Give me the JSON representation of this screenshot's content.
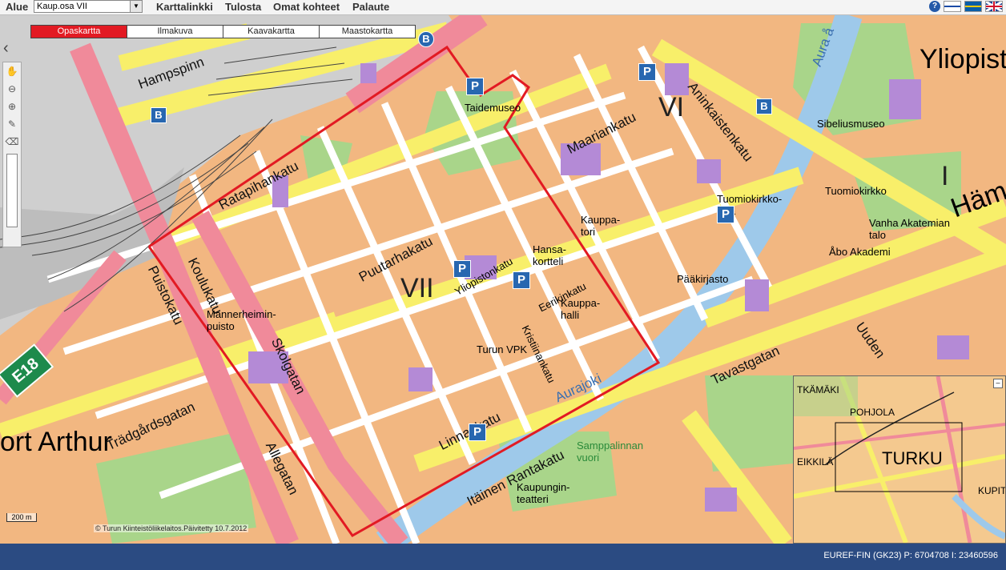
{
  "header": {
    "alue_label": "Alue",
    "alue_value": "Kaup.osa VII",
    "menu": [
      "Karttalinkki",
      "Tulosta",
      "Omat kohteet",
      "Palaute"
    ],
    "help": "?"
  },
  "tabs": [
    {
      "label": "Opaskartta",
      "active": true
    },
    {
      "label": "Ilmakuva",
      "active": false
    },
    {
      "label": "Kaavakartta",
      "active": false
    },
    {
      "label": "Maastokartta",
      "active": false
    }
  ],
  "map": {
    "scale": "200 m",
    "copyright": "© Turun Kiinteistöliikelaitos.Päivitetty 10.7.2012",
    "labels": {
      "vii": "VII",
      "vi": "VI",
      "i": "I",
      "port_arthur": "ort Arthur",
      "ylioplisto": "Yliopist",
      "hame": "Häme",
      "e18": "E18",
      "koulukatu": "Koulukatu",
      "skolgatan": "Skolgatan",
      "puistokatu": "Puistokatu",
      "allegatan": "Allegatan",
      "ratapihankatu": "Ratapihankatu",
      "puutarhakatu": "Puutarhakatu",
      "itainen_rantakatu": "Itäinen Rantakatu",
      "tavastgatan": "Tavastgatan",
      "aninkaistenkatu": "Aninkaistenkatu",
      "hampspinn": "Hampspinn",
      "kauppatori": "Kauppa-\ntori",
      "kauppahalli": "Kauppa-\nhalli",
      "mannerheimin_puisto": "Mannerheimin-\npuisto",
      "aurajoki": "Aurajoki",
      "aura": "Aura å",
      "unden": "Uuden",
      "tradgardsgatan": "Trädgårdsgatan",
      "eerikinkatu": "Eerikinkatu",
      "linnankatu": "Linnankatu",
      "kristiinankatu": "Kristiinankatu",
      "yliopistonkatu": "Yliopistonkatu",
      "maariankatu": "Maariankatu",
      "tuomiokirkkosilta": "Tuomiokirkko-\nsilta",
      "sibeliusmuseo": "Sibeliusmuseo",
      "tuomiokirkko": "Tuomiokirkko",
      "vanha_akatemian_talo": "Vanha Akatemian\ntalo",
      "abo_akademi": "Åbo Akademi",
      "taidemuseo": "Taidemuseo",
      "turun_vpk": "Turun VPK",
      "hansa": "Hansa-\nkortteli",
      "kaupunginteatteri": "Kaupungin-\nteatteri",
      "samppalinnan_vuori": "Samppalinnan\nvuori",
      "paakirjasto": "Pääkirjasto",
      "ylioplisto_short": "Yliopist"
    },
    "overview": {
      "labels": [
        "TKÄMÄKI",
        "POHJOLA",
        "TURKU",
        "EIKKILÄ",
        "KUPIT"
      ]
    }
  },
  "statusbar": {
    "coords": "EUREF-FIN (GK23) P: 6704708 I: 23460596"
  },
  "colors": {
    "map_bg": "#f2b781",
    "road_yellow": "#f8ef6a",
    "road_pink": "#f08a9a",
    "park_green": "#a9d58a",
    "water_blue": "#9ec9ea",
    "building_purple": "#b48ad6",
    "boundary_red": "#e21a23",
    "status_blue": "#2b4b82"
  }
}
